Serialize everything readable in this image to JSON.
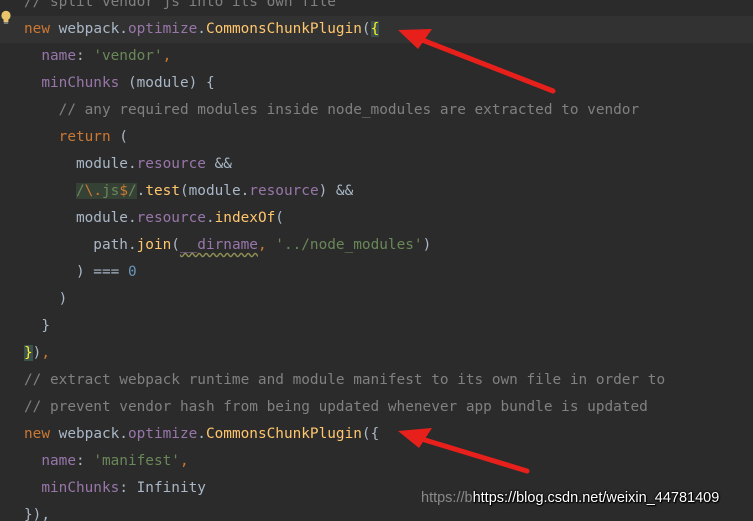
{
  "editor": {
    "lines": [
      {
        "tokens": [
          {
            "t": "// split vendor js into its own file",
            "c": "comment"
          }
        ]
      },
      {
        "current": true,
        "tokens": [
          {
            "t": "new",
            "c": "keyword"
          },
          {
            "t": " webpack.",
            "c": "plain"
          },
          {
            "t": "optimize",
            "c": "prop"
          },
          {
            "t": ".",
            "c": "plain"
          },
          {
            "t": "CommonsChunkPlugin",
            "c": "func"
          },
          {
            "t": "(",
            "c": "plain"
          },
          {
            "t": "{",
            "c": "brace-hl"
          }
        ]
      },
      {
        "tokens": [
          {
            "t": "  ",
            "c": "plain"
          },
          {
            "t": "name",
            "c": "prop"
          },
          {
            "t": ": ",
            "c": "plain"
          },
          {
            "t": "'vendor'",
            "c": "string"
          },
          {
            "t": ",",
            "c": "keyword"
          }
        ]
      },
      {
        "tokens": [
          {
            "t": "  ",
            "c": "plain"
          },
          {
            "t": "minChunks",
            "c": "prop"
          },
          {
            "t": " (module) {",
            "c": "plain"
          }
        ]
      },
      {
        "tokens": [
          {
            "t": "    // any required modules inside node_modules are extracted to vendor",
            "c": "comment"
          }
        ]
      },
      {
        "tokens": [
          {
            "t": "    ",
            "c": "plain"
          },
          {
            "t": "return",
            "c": "keyword"
          },
          {
            "t": " (",
            "c": "plain"
          }
        ]
      },
      {
        "tokens": [
          {
            "t": "      module.",
            "c": "plain"
          },
          {
            "t": "resource",
            "c": "prop"
          },
          {
            "t": " &&",
            "c": "plain"
          }
        ]
      },
      {
        "tokens": [
          {
            "t": "      ",
            "c": "plain"
          },
          {
            "t": "/",
            "c": "string regex-bg"
          },
          {
            "t": "\\.",
            "c": "keyword regex-bg"
          },
          {
            "t": "js",
            "c": "string regex-bg"
          },
          {
            "t": "$",
            "c": "keyword regex-bg"
          },
          {
            "t": "/",
            "c": "string regex-bg"
          },
          {
            "t": ".",
            "c": "plain"
          },
          {
            "t": "test",
            "c": "func"
          },
          {
            "t": "(module.",
            "c": "plain"
          },
          {
            "t": "resource",
            "c": "prop"
          },
          {
            "t": ") &&",
            "c": "plain"
          }
        ]
      },
      {
        "tokens": [
          {
            "t": "      module.",
            "c": "plain"
          },
          {
            "t": "resource",
            "c": "prop"
          },
          {
            "t": ".",
            "c": "plain"
          },
          {
            "t": "indexOf",
            "c": "func"
          },
          {
            "t": "(",
            "c": "plain"
          }
        ]
      },
      {
        "tokens": [
          {
            "t": "        path.",
            "c": "plain"
          },
          {
            "t": "join",
            "c": "func"
          },
          {
            "t": "(",
            "c": "plain"
          },
          {
            "t": "__dirname",
            "c": "prop wavy"
          },
          {
            "t": ", ",
            "c": "keyword"
          },
          {
            "t": "'../node_modules'",
            "c": "string"
          },
          {
            "t": ")",
            "c": "plain"
          }
        ]
      },
      {
        "tokens": [
          {
            "t": "      ) === ",
            "c": "plain"
          },
          {
            "t": "0",
            "c": "number"
          }
        ]
      },
      {
        "tokens": [
          {
            "t": "    )",
            "c": "plain"
          }
        ]
      },
      {
        "tokens": [
          {
            "t": "  }",
            "c": "plain"
          }
        ]
      },
      {
        "tokens": [
          {
            "t": "}",
            "c": "brace-hl"
          },
          {
            "t": ")",
            "c": "plain"
          },
          {
            "t": ",",
            "c": "keyword"
          }
        ]
      },
      {
        "tokens": [
          {
            "t": "// extract webpack runtime and module manifest to its own file in order to",
            "c": "comment"
          }
        ]
      },
      {
        "tokens": [
          {
            "t": "// prevent vendor hash from being updated whenever app bundle is updated",
            "c": "comment"
          }
        ]
      },
      {
        "tokens": [
          {
            "t": "new",
            "c": "keyword"
          },
          {
            "t": " webpack.",
            "c": "plain"
          },
          {
            "t": "optimize",
            "c": "prop"
          },
          {
            "t": ".",
            "c": "plain"
          },
          {
            "t": "CommonsChunkPlugin",
            "c": "func"
          },
          {
            "t": "({",
            "c": "plain"
          }
        ]
      },
      {
        "tokens": [
          {
            "t": "  ",
            "c": "plain"
          },
          {
            "t": "name",
            "c": "prop"
          },
          {
            "t": ": ",
            "c": "plain"
          },
          {
            "t": "'manifest'",
            "c": "string"
          },
          {
            "t": ",",
            "c": "keyword"
          }
        ]
      },
      {
        "tokens": [
          {
            "t": "  ",
            "c": "plain"
          },
          {
            "t": "minChunks",
            "c": "prop"
          },
          {
            "t": ": Infinity",
            "c": "plain"
          }
        ]
      },
      {
        "tokens": [
          {
            "t": "}),",
            "c": "plain"
          }
        ]
      }
    ]
  },
  "watermark": {
    "ghost": "https://b",
    "text": "https://blog.csdn.net/weixin_44781409"
  },
  "icons": {
    "intention": "lightbulb-icon",
    "annotation": "arrow-icon"
  },
  "colors": {
    "background": "#2b2b2b",
    "keyword": "#cc7832",
    "string": "#6a8759",
    "comment": "#808080",
    "function": "#ffc66d",
    "property": "#9876aa",
    "arrow": "#e8201c"
  }
}
